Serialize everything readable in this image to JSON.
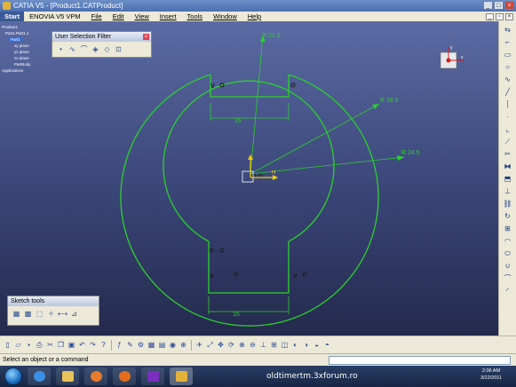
{
  "window": {
    "title": "CATIA V5 - [Product1.CATProduct]"
  },
  "menu": [
    "Start",
    "ENOVIA V5 VPM",
    "File",
    "Edit",
    "View",
    "Insert",
    "Tools",
    "Window",
    "Help"
  ],
  "tree": {
    "nodes": [
      "Product1",
      "Part1.Part1.1",
      "Part1",
      "xy plane",
      "yz plane",
      "zx plane",
      "PartBody",
      "Applications"
    ]
  },
  "user_selection_filter": {
    "title": "User Selection Filter"
  },
  "sketch_tools": {
    "title": "Sketch tools"
  },
  "dimensions": {
    "r_outer": "R 21.5",
    "r_inner": "R 16.5",
    "r_mid": "R 24.5",
    "width_top": "15",
    "width_bottom": "15",
    "v_top": "V",
    "v_bottom": "V",
    "h_label": "H",
    "v_axis": "V"
  },
  "compass": {
    "x": "x",
    "y": "y",
    "z": "z"
  },
  "status": {
    "message": "Select an object or a command"
  },
  "taskbar": {
    "watermark": "oldtimertm.3xforum.ro",
    "time": "2:06 AM",
    "date": "3/22/2011"
  },
  "colors": {
    "sketch": "#2bd12b",
    "axis_h": "#f0d000",
    "bg_top": "#5a6aa3",
    "bg_bottom": "#242a4d"
  }
}
